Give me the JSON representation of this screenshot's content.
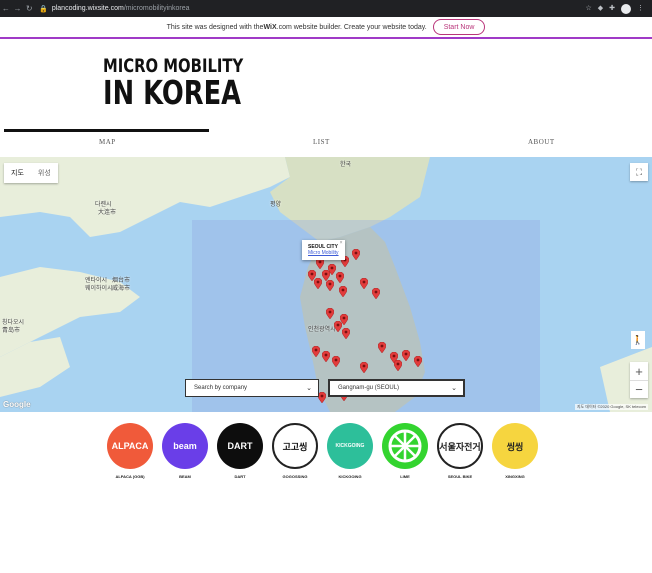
{
  "browser": {
    "url_host": "plancoding.wixsite.com",
    "url_path": "/micromobilityinkorea"
  },
  "wix_banner": {
    "text_before": "This site was designed with the ",
    "brand": "WiX",
    "text_after": ".com website builder. Create your website today.",
    "cta": "Start Now"
  },
  "site": {
    "logo_line1": "MICRO MOBILITY",
    "logo_line2": "IN KOREA"
  },
  "nav": {
    "items": [
      {
        "label": "MAP",
        "active": true
      },
      {
        "label": "LIST",
        "active": false
      },
      {
        "label": "ABOUT",
        "active": false
      }
    ]
  },
  "map": {
    "type_toggle": [
      "지도",
      "위성"
    ],
    "labels": [
      "다롄시",
      "大连市",
      "평양",
      "엔타이시",
      "烟台市",
      "웨이하이시",
      "威海市",
      "칭다오시",
      "青岛市",
      "한국",
      "인천광역시"
    ],
    "popup": {
      "title": "SEOUL CITY",
      "link": "Micro Mobility"
    },
    "attribution": "지도 데이터 ©2020 Google, SK telecom",
    "google": "Google",
    "zoom_in": "+",
    "zoom_out": "−",
    "search_company": {
      "placeholder": "Search by company"
    },
    "search_region": {
      "value": "Gangnam-gu (SEOUL)"
    }
  },
  "companies": [
    {
      "name": "ALPACA (GGB)",
      "logo_text": "ALPACA",
      "bg": "#f05a3a",
      "fg": "#ffffff"
    },
    {
      "name": "BEAM",
      "logo_text": "beam",
      "bg": "#6a3ee8",
      "fg": "#ffffff"
    },
    {
      "name": "DART",
      "logo_text": "DART",
      "bg": "#0d0d0d",
      "fg": "#ffffff"
    },
    {
      "name": "GOGOSSING",
      "logo_text": "고고씽",
      "bg": "#ffffff",
      "fg": "#111111"
    },
    {
      "name": "KICKGOING",
      "logo_text": "KICKGOING",
      "bg": "#2dbf9a",
      "fg": "#ffffff"
    },
    {
      "name": "LIME",
      "logo_text": "",
      "bg": "#33d42f",
      "fg": "#ffffff"
    },
    {
      "name": "SEOUL BIKE",
      "logo_text": "서울자전거",
      "bg": "#ffffff",
      "fg": "#222222"
    },
    {
      "name": "XINGXING",
      "logo_text": "씽씽",
      "bg": "#f6d53f",
      "fg": "#222222"
    }
  ]
}
